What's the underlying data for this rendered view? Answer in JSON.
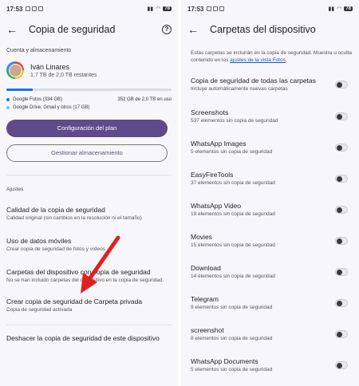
{
  "left": {
    "status": {
      "time": "17:53",
      "battery": "78"
    },
    "appbar": {
      "back_icon": "arrow-back-icon",
      "title": "Copia de seguridad",
      "help_icon": "help-icon"
    },
    "account_section": {
      "label": "Cuenta y almacenamiento"
    },
    "account": {
      "name": "Iván Linares",
      "storage_remaining": "1,7 TB de 2,0 TB restantes"
    },
    "storage": {
      "photos_fraction": 0.16,
      "photos": {
        "label": "Google Fotos (334 GB)",
        "color": "#1a73e8",
        "usage": "352 GB de 2,0 TB en uso"
      },
      "other": {
        "label": "Google Drive, Gmail y otros (17 GB)",
        "color": "#8ab4f8"
      }
    },
    "buttons": {
      "plan": "Configuración del plan",
      "manage": "Gestionar almacenamiento"
    },
    "settings_section": {
      "label": "Ajustes"
    },
    "settings": [
      {
        "title": "Calidad de la copia de seguridad",
        "sub": "Calidad original (sin cambios en la resolución ni el tamaño)"
      },
      {
        "title": "Uso de datos móviles",
        "sub": "Crear copia de seguridad de fotos y vídeos"
      },
      {
        "title": "Carpetas del dispositivo con copia de seguridad",
        "sub": "No se han incluido carpetas del dispositivo en la copia de seguridad."
      },
      {
        "title": "Crear copia de seguridad de Carpeta privada",
        "sub": "Copia de seguridad activada"
      },
      {
        "title": "Deshacer la copia de seguridad de este dispositivo",
        "sub": ""
      }
    ],
    "annotation_color": "#e02020"
  },
  "right": {
    "status": {
      "time": "17:53",
      "battery": "78"
    },
    "appbar": {
      "back_icon": "arrow-back-icon",
      "title": "Carpetas del dispositivo"
    },
    "intro": {
      "text": "Estas carpetas se incluirán en la copia de seguridad. Muestra u oculta contenido en los ",
      "link": "ajustes de la vista Fotos",
      "end": "."
    },
    "all_folders": {
      "title": "Copia de seguridad de todas las carpetas",
      "sub": "Incluye automáticamente nuevas carpetas",
      "enabled": false
    },
    "folders": [
      {
        "name": "Screenshots",
        "count": "537 elementos sin copia de seguridad",
        "enabled": false
      },
      {
        "name": "WhatsApp Images",
        "count": "5 elementos sin copia de seguridad",
        "enabled": false
      },
      {
        "name": "EasyFireTools",
        "count": "37 elementos sin copia de seguridad",
        "enabled": false
      },
      {
        "name": "WhatsApp Video",
        "count": "19 elementos sin copia de seguridad",
        "enabled": false
      },
      {
        "name": "Movies",
        "count": "15 elementos sin copia de seguridad",
        "enabled": false
      },
      {
        "name": "Download",
        "count": "14 elementos sin copia de seguridad",
        "enabled": false
      },
      {
        "name": "Telegram",
        "count": "9 elementos sin copia de seguridad",
        "enabled": false
      },
      {
        "name": "screenshot",
        "count": "8 elementos sin copia de seguridad",
        "enabled": false
      },
      {
        "name": "WhatsApp Documents",
        "count": "5 elementos sin copia de seguridad",
        "enabled": false
      }
    ]
  }
}
